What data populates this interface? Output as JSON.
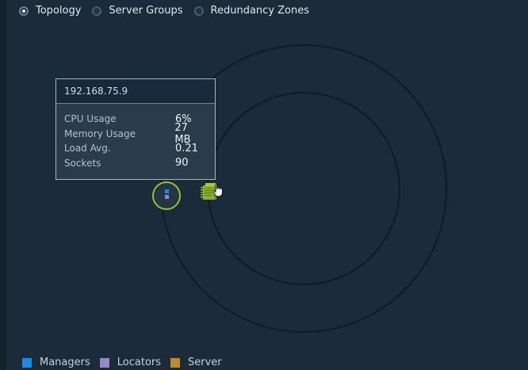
{
  "view_options": {
    "items": [
      {
        "label": "Topology",
        "selected": true
      },
      {
        "label": "Server Groups",
        "selected": false
      },
      {
        "label": "Redundancy Zones",
        "selected": false
      }
    ]
  },
  "tooltip": {
    "title": "192.168.75.9",
    "metrics": [
      {
        "label": "CPU Usage",
        "value": "6%"
      },
      {
        "label": "Memory Usage",
        "value": "27 MB"
      },
      {
        "label": "Load Avg.",
        "value": "0.21"
      },
      {
        "label": "Sockets",
        "value": "90"
      }
    ]
  },
  "nodes": {
    "locator_icon": "locator-node-icon",
    "server_icon": "server-node-icon",
    "selected_ring_color": "#9bbf2e"
  },
  "legend": {
    "items": [
      {
        "label": "Managers",
        "color": "#1e88e5"
      },
      {
        "label": "Locators",
        "color": "#9588c9"
      },
      {
        "label": "Server",
        "color": "#c08a2b"
      }
    ]
  },
  "colors": {
    "background": "#1b2b3a",
    "tooltip_header": "#17293a",
    "server_green": "#8db32e"
  }
}
